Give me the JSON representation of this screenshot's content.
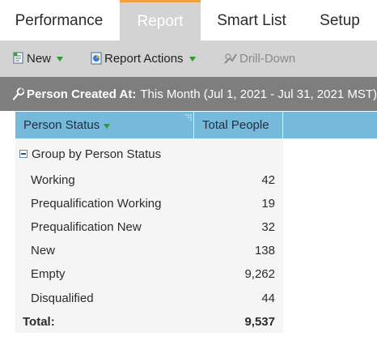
{
  "tabs": [
    {
      "label": "Performance",
      "active": false
    },
    {
      "label": "Report",
      "active": true
    },
    {
      "label": "Smart List",
      "active": false
    },
    {
      "label": "Setup",
      "active": false
    }
  ],
  "toolbar": {
    "new_label": "New",
    "report_actions_label": "Report Actions",
    "drill_down_label": "Drill-Down"
  },
  "filter": {
    "label": "Person Created At:",
    "value": "This Month (Jul 1, 2021 - Jul 31, 2021 MST)"
  },
  "table": {
    "columns": [
      "Person Status",
      "Total People"
    ],
    "group_label": "Group by Person Status",
    "rows": [
      {
        "status": "Working",
        "total": "42"
      },
      {
        "status": "Prequalification Working",
        "total": "19"
      },
      {
        "status": "Prequalification New",
        "total": "32"
      },
      {
        "status": "New",
        "total": "138"
      },
      {
        "status": "Empty",
        "total": "9,262"
      },
      {
        "status": "Disqualified",
        "total": "44"
      }
    ],
    "total": {
      "label": "Total:",
      "value": "9,537"
    }
  },
  "colors": {
    "tab_active_bg": "#d3d3d3",
    "tab_active_accent": "#f0a040",
    "toolbar_bg": "#d3d3d3",
    "filter_bg": "#7e7e7e",
    "header_bg": "#76b9db",
    "table_bg": "#f5f5f5"
  }
}
